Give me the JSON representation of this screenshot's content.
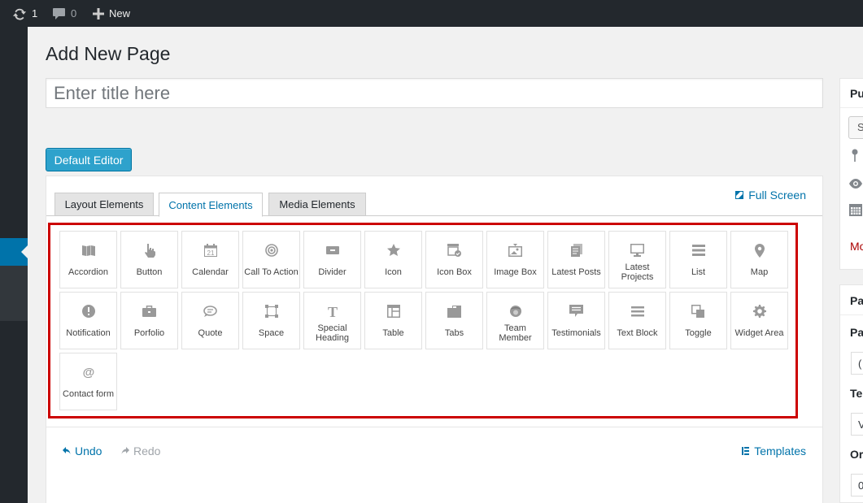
{
  "admin_bar": {
    "updates_count": "1",
    "comments_count": "0",
    "new_label": "New"
  },
  "page": {
    "title": "Add New Page",
    "title_placeholder": "Enter title here"
  },
  "editor": {
    "default_editor_label": "Default Editor",
    "tabs": [
      {
        "label": "Layout Elements",
        "active": false
      },
      {
        "label": "Content Elements",
        "active": true
      },
      {
        "label": "Media Elements",
        "active": false
      }
    ],
    "full_screen_label": "Full Screen",
    "undo_label": "Undo",
    "redo_label": "Redo",
    "templates_label": "Templates"
  },
  "elements": [
    {
      "label": "Accordion",
      "icon": "book-icon"
    },
    {
      "label": "Button",
      "icon": "hand-pointer-icon"
    },
    {
      "label": "Calendar",
      "icon": "calendar-icon"
    },
    {
      "label": "Call To Action",
      "icon": "target-icon"
    },
    {
      "label": "Divider",
      "icon": "divider-icon"
    },
    {
      "label": "Icon",
      "icon": "star-icon"
    },
    {
      "label": "Icon Box",
      "icon": "icon-box-icon"
    },
    {
      "label": "Image Box",
      "icon": "image-box-icon"
    },
    {
      "label": "Latest Posts",
      "icon": "posts-icon"
    },
    {
      "label": "Latest Projects",
      "icon": "monitor-icon"
    },
    {
      "label": "List",
      "icon": "list-icon"
    },
    {
      "label": "Map",
      "icon": "map-pin-icon"
    },
    {
      "label": "Notification",
      "icon": "alert-icon"
    },
    {
      "label": "Porfolio",
      "icon": "briefcase-icon"
    },
    {
      "label": "Quote",
      "icon": "speech-bubble-icon"
    },
    {
      "label": "Space",
      "icon": "crop-icon"
    },
    {
      "label": "Special Heading",
      "icon": "text-t-icon"
    },
    {
      "label": "Table",
      "icon": "table-icon"
    },
    {
      "label": "Tabs",
      "icon": "tabs-icon"
    },
    {
      "label": "Team Member",
      "icon": "person-icon"
    },
    {
      "label": "Testimonials",
      "icon": "testimonial-icon"
    },
    {
      "label": "Text Block",
      "icon": "text-block-icon"
    },
    {
      "label": "Toggle",
      "icon": "toggle-icon"
    },
    {
      "label": "Widget Area",
      "icon": "gear-icon"
    },
    {
      "label": "Contact form",
      "icon": "at-sign-icon"
    }
  ],
  "sidebar": {
    "publish_title": "Pu",
    "save_button": "S",
    "more_link": "Mo",
    "page_attrs_title": "Pa",
    "parent_label": "Pa",
    "parent_value": "(",
    "template_label": "Te",
    "template_value": "V",
    "order_label": "Or",
    "order_value": "0"
  },
  "colors": {
    "admin_bar": "#23282d",
    "primary_button": "#2ea2cc",
    "link": "#0073aa",
    "highlight_border": "#cc0000",
    "icon_gray": "#999999"
  }
}
